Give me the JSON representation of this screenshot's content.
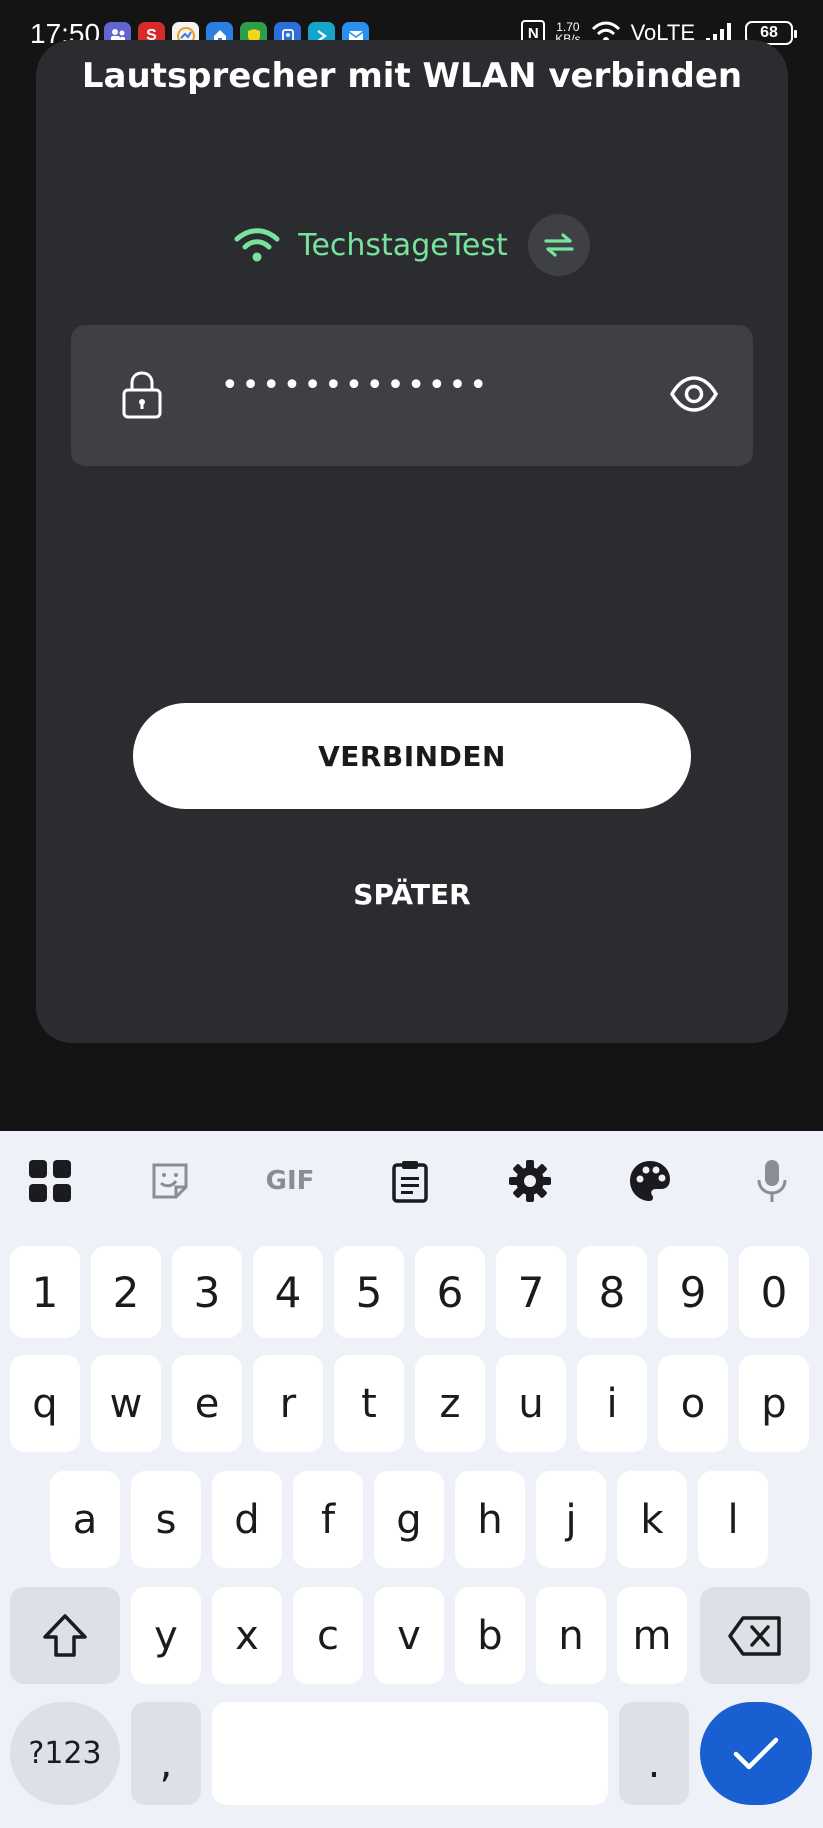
{
  "status_bar": {
    "time": "17:50",
    "notifications": [
      {
        "icon": "teams-icon",
        "color": "#6264d1",
        "glyph": ""
      },
      {
        "icon": "s-app-icon",
        "color": "#d72a2a",
        "glyph": "S"
      },
      {
        "icon": "chart-app-icon",
        "color": "#f3f3f3",
        "glyph": ""
      },
      {
        "icon": "home-app-icon",
        "color": "#2b7fe0",
        "glyph": ""
      },
      {
        "icon": "shield-app-icon",
        "color": "#2e9e4a",
        "glyph": ""
      },
      {
        "icon": "id-app-icon",
        "color": "#2c6fd8",
        "glyph": ""
      },
      {
        "icon": "arrow-app-icon",
        "color": "#14a6c9",
        "glyph": ""
      },
      {
        "icon": "mail-app-icon",
        "color": "#2b8ff2",
        "glyph": ""
      }
    ],
    "nfc": "N",
    "speed_value": "1.70",
    "speed_unit": "KB/s",
    "network": "VoLTE",
    "battery": "68"
  },
  "dialog": {
    "title": "Lautsprecher mit WLAN verbinden",
    "ssid": "TechstageTest",
    "password_masked": "•••••••••••••",
    "connect_label": "VERBINDEN",
    "later_label": "SPÄTER",
    "accent_color": "#77e39c"
  },
  "keyboard": {
    "toolbar": [
      "apps-icon",
      "sticker-icon",
      "gif-icon",
      "clipboard-icon",
      "settings-icon",
      "palette-icon",
      "mic-icon"
    ],
    "gif_label": "GIF",
    "number_row": [
      "1",
      "2",
      "3",
      "4",
      "5",
      "6",
      "7",
      "8",
      "9",
      "0"
    ],
    "row1": [
      "q",
      "w",
      "e",
      "r",
      "t",
      "z",
      "u",
      "i",
      "o",
      "p"
    ],
    "row2": [
      "a",
      "s",
      "d",
      "f",
      "g",
      "h",
      "j",
      "k",
      "l"
    ],
    "row3": [
      "y",
      "x",
      "c",
      "v",
      "b",
      "n",
      "m"
    ],
    "symbols_label": "?123",
    "comma": ",",
    "period": ".",
    "enter_color": "#1a5fd1"
  }
}
